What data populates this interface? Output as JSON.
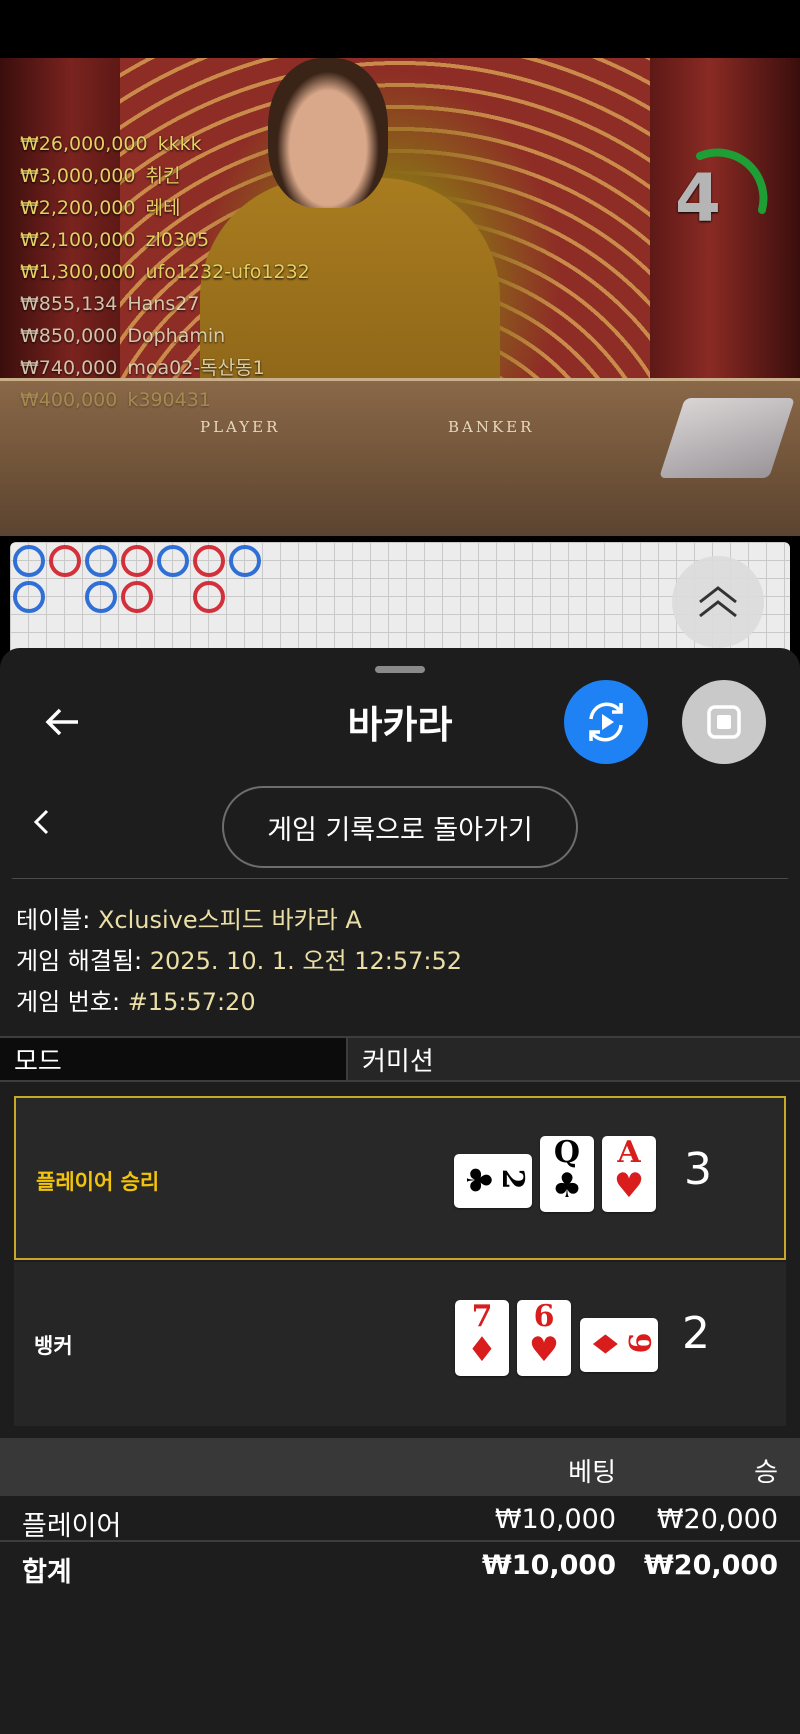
{
  "video": {
    "felt_labels": [
      "PLAYER",
      "BANKER"
    ],
    "countdown": "4",
    "winners": [
      {
        "amount": "₩26,000,000",
        "name": "kkkk"
      },
      {
        "amount": "₩3,000,000",
        "name": "취킨"
      },
      {
        "amount": "₩2,200,000",
        "name": "레테"
      },
      {
        "amount": "₩2,100,000",
        "name": "zl0305"
      },
      {
        "amount": "₩1,300,000",
        "name": "ufo1232-ufo1232"
      },
      {
        "amount": "₩855,134",
        "name": "Hans27"
      },
      {
        "amount": "₩850,000",
        "name": "Dophamin"
      },
      {
        "amount": "₩740,000",
        "name": "moa02-독산동1"
      },
      {
        "amount": "₩400,000",
        "name": "k390431"
      }
    ]
  },
  "roadmap": {
    "colors": {
      "player": "#2f6fd6",
      "banker": "#d2303a"
    },
    "columns": [
      [
        "P",
        "P"
      ],
      [
        "B"
      ],
      [
        "P",
        "P"
      ],
      [
        "B",
        "B"
      ],
      [
        "P"
      ],
      [
        "B",
        "B"
      ],
      [
        "P"
      ]
    ]
  },
  "header": {
    "title": "바카라",
    "back_icon": "arrow-left-icon",
    "live_icon": "live-replay-icon",
    "stop_icon": "stop-square-icon"
  },
  "history_button": "게임 기록으로 돌아가기",
  "info": {
    "table_label": "테이블:",
    "table_value": "Xclusive스피드 바카라 A",
    "resolved_label": "게임 해결됨:",
    "resolved_value": "2025. 10. 1. 오전 12:57:52",
    "number_label": "게임 번호:",
    "number_value": "#15:57:20"
  },
  "tabs": {
    "mode": "모드",
    "commission": "커미션"
  },
  "hands": {
    "player": {
      "label": "플레이어 승리",
      "score": "3",
      "cards": [
        {
          "rank": "2",
          "suit": "♣",
          "color": "black",
          "orientation": "sideways"
        },
        {
          "rank": "Q",
          "suit": "♣",
          "color": "black",
          "orientation": "upright"
        },
        {
          "rank": "A",
          "suit": "♥",
          "color": "red",
          "orientation": "upright"
        }
      ]
    },
    "banker": {
      "label": "뱅커",
      "score": "2",
      "cards": [
        {
          "rank": "7",
          "suit": "♦",
          "color": "red",
          "orientation": "upright"
        },
        {
          "rank": "6",
          "suit": "♥",
          "color": "red",
          "orientation": "upright"
        },
        {
          "rank": "9",
          "suit": "♦",
          "color": "red",
          "orientation": "sideways"
        }
      ]
    }
  },
  "bets": {
    "head": {
      "bet": "베팅",
      "win": "승"
    },
    "rows": [
      {
        "name": "플레이어",
        "bet": "₩10,000",
        "win": "₩20,000"
      }
    ],
    "total": {
      "name": "합계",
      "bet": "₩10,000",
      "win": "₩20,000"
    }
  },
  "colors": {
    "accent_blue": "#1e82f5",
    "win_gold": "#f2c40c",
    "info_value": "#ebdfa6"
  }
}
